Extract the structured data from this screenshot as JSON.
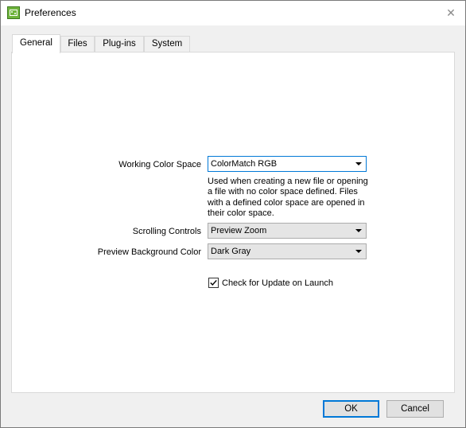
{
  "window": {
    "title": "Preferences",
    "close_glyph": "✕",
    "icon": "app-icon"
  },
  "tabs": [
    {
      "label": "General",
      "active": true
    },
    {
      "label": "Files",
      "active": false
    },
    {
      "label": "Plug-ins",
      "active": false
    },
    {
      "label": "System",
      "active": false
    }
  ],
  "general": {
    "working_color_space": {
      "label": "Working Color Space",
      "value": "ColorMatch RGB",
      "help": "Used when creating a new file or opening a file with no color space defined. Files with a defined color space are opened in their color space."
    },
    "scrolling_controls": {
      "label": "Scrolling Controls",
      "value": "Preview Zoom"
    },
    "preview_background": {
      "label": "Preview Background Color",
      "value": "Dark Gray"
    },
    "check_update": {
      "label": "Check for Update on Launch",
      "checked": true
    }
  },
  "buttons": {
    "ok": "OK",
    "cancel": "Cancel"
  },
  "colors": {
    "accent": "#0078d7",
    "panel_bg": "#ffffff",
    "window_bg": "#f0f0f0"
  }
}
